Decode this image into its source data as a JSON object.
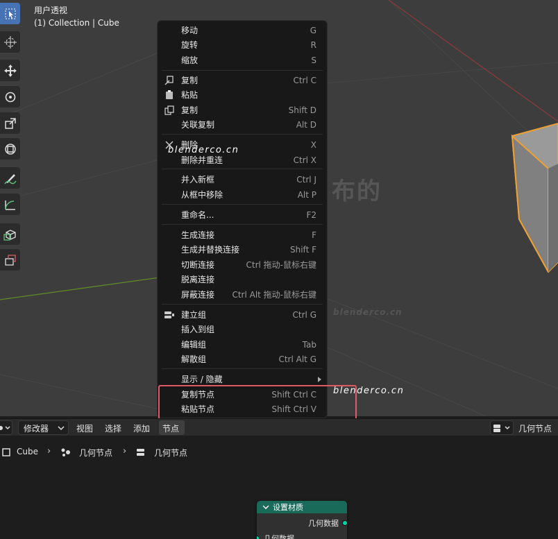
{
  "viewport": {
    "title": "用户透视",
    "subtitle": "(1) Collection | Cube"
  },
  "toolbar": {
    "tools": [
      {
        "icon": "select-box-icon",
        "active": true
      },
      {
        "icon": "cursor-icon"
      },
      {
        "icon": "move-icon"
      },
      {
        "icon": "rotate-icon"
      },
      {
        "icon": "scale-icon"
      },
      {
        "icon": "transform-icon"
      },
      {
        "icon": "annotate-icon"
      },
      {
        "icon": "measure-icon"
      },
      {
        "icon": "add-cube-icon"
      },
      {
        "icon": "extrude-icon"
      }
    ]
  },
  "watermark": {
    "text_cn": "布的",
    "text_url": "blenderco.cn"
  },
  "menu": {
    "items": [
      {
        "label": "移动",
        "shortcut": "G"
      },
      {
        "label": "旋转",
        "shortcut": "R"
      },
      {
        "label": "缩放",
        "shortcut": "S"
      },
      {
        "label": "复制",
        "shortcut": "Ctrl C",
        "icon": "copy-icon"
      },
      {
        "label": "粘贴",
        "shortcut": "",
        "icon": "paste-icon"
      },
      {
        "label": "复制",
        "shortcut": "Shift D",
        "icon": "duplicate-icon"
      },
      {
        "label": "关联复制",
        "shortcut": "Alt D"
      },
      {
        "label": "删除",
        "shortcut": "X",
        "icon": "delete-x-icon"
      },
      {
        "label": "删除并重连",
        "shortcut": "Ctrl X"
      },
      {
        "label": "并入新框",
        "shortcut": "Ctrl J"
      },
      {
        "label": "从框中移除",
        "shortcut": "Alt P"
      },
      {
        "label": "重命名...",
        "shortcut": "F2"
      },
      {
        "label": "生成连接",
        "shortcut": "F"
      },
      {
        "label": "生成并替换连接",
        "shortcut": "Shift F"
      },
      {
        "label": "切断连接",
        "shortcut": "Ctrl 拖动-鼠标右键"
      },
      {
        "label": "脱离连接",
        "shortcut": ""
      },
      {
        "label": "屏蔽连接",
        "shortcut": "Ctrl Alt 拖动-鼠标右键"
      },
      {
        "label": "建立组",
        "shortcut": "Ctrl G",
        "icon": "node-group-icon"
      },
      {
        "label": "插入到组",
        "shortcut": ""
      },
      {
        "label": "编辑组",
        "shortcut": "Tab"
      },
      {
        "label": "解散组",
        "shortcut": "Ctrl Alt G"
      },
      {
        "label": "显示 / 隐藏",
        "shortcut": "",
        "submenu": true
      },
      {
        "label": "复制节点",
        "shortcut": "Shift Ctrl C"
      },
      {
        "label": "粘贴节点",
        "shortcut": "Shift Ctrl V"
      }
    ]
  },
  "header": {
    "editor_type": "",
    "modifier": "修改器",
    "view": "视图",
    "select": "选择",
    "add": "添加",
    "node": "节点",
    "tree_type": "几何节点"
  },
  "breadcrumb": {
    "object": "Cube",
    "modifier": "几何节点",
    "tree": "几何节点"
  },
  "node": {
    "title": "设置材质",
    "output": "几何数据",
    "input": "几何数据"
  },
  "colors": {
    "accent": "#4772b3",
    "highlight": "#e05a67",
    "node_header": "#1a6a5a",
    "socket": "#00d6a3",
    "selection_outline": "#f0a030"
  }
}
